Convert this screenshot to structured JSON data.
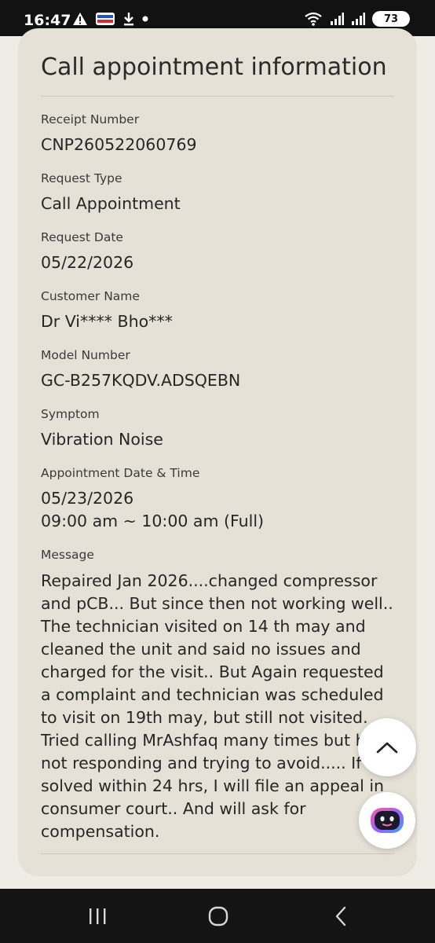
{
  "status_bar": {
    "time": "16:47",
    "battery_level": "73"
  },
  "card": {
    "title": "Call appointment information",
    "fields": [
      {
        "label": "Receipt Number",
        "value": "CNP260522060769"
      },
      {
        "label": "Request Type",
        "value": "Call Appointment"
      },
      {
        "label": "Request Date",
        "value": "05/22/2026"
      },
      {
        "label": "Customer Name",
        "value": "Dr Vi**** Bho***"
      },
      {
        "label": "Model Number",
        "value": "GC-B257KQDV.ADSQEBN"
      },
      {
        "label": "Symptom",
        "value": "Vibration Noise"
      }
    ],
    "appointment": {
      "label": "Appointment Date & Time",
      "date": "05/23/2026",
      "time": "09:00 am ~ 10:00 am (Full)"
    },
    "message": {
      "label": "Message",
      "value": "Repaired Jan 2026....changed compressor and pCB... But since then not working well.. The technician visited on 14 th may and cleaned the unit and said no issues and charged for the visit.. But Again requested a complaint and technician was scheduled to visit on 19th may, but still not visited. Tried calling MrAshfaq many times but he is not responding and trying to avoid..... If not solved within 24 hrs, I will file an appeal in consumer court.. And will ask for compensation."
    }
  },
  "floating_buttons": {
    "scroll_top_icon": "chevron-up-icon",
    "assistant_icon": "robot-assistant-icon"
  },
  "nav_bar": {
    "recent_icon": "recent-apps-icon",
    "home_icon": "home-icon",
    "back_icon": "back-icon"
  },
  "colors": {
    "page_background": "#efece6",
    "card_background": "#e5e1d6",
    "status_bar": "#121212",
    "nav_bar": "#141414"
  }
}
